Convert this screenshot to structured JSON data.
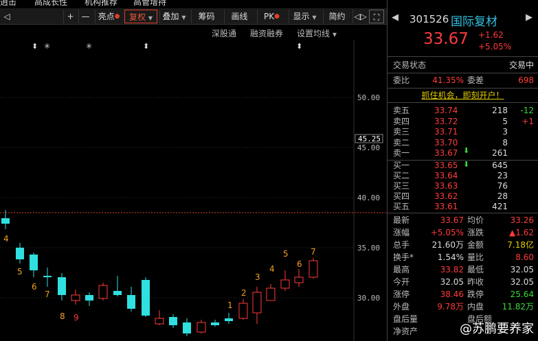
{
  "top_strip": [
    "逍击",
    "高成长性",
    "机构推荐",
    "高管增持"
  ],
  "toolbar": {
    "items": [
      {
        "label": "◁",
        "icon": "back-icon"
      },
      {
        "label": "+",
        "icon": "zoom-in-icon"
      },
      {
        "label": "—",
        "icon": "zoom-out-icon"
      },
      {
        "label": "亮点"
      },
      {
        "label": "复权"
      },
      {
        "label": "叠加"
      },
      {
        "label": "筹码"
      },
      {
        "label": "画线"
      },
      {
        "label": "PK"
      },
      {
        "label": "显示"
      },
      {
        "label": "简约"
      },
      {
        "label": "◁▷",
        "icon": "arrows-icon"
      },
      {
        "label": "⛶",
        "icon": "fullscreen-icon"
      }
    ]
  },
  "subbar": {
    "a": "深股通",
    "b": "融资融券",
    "c": "设置均线"
  },
  "chart": {
    "price_ref": "45.25",
    "y_labels": [
      "50.00",
      "45.00",
      "40.00",
      "35.00",
      "30.00"
    ],
    "markers": [
      "⬍",
      "✳",
      "✳",
      "⬍",
      "⬍"
    ],
    "count_labels": [
      "4",
      "5",
      "6",
      "7",
      "8",
      "9",
      "1",
      "2",
      "3",
      "4",
      "5",
      "6",
      "7"
    ]
  },
  "quote": {
    "code": "301526",
    "name": "国际复材",
    "price": "33.67",
    "change": "+1.62",
    "pct": "+5.05%",
    "status_label": "交易状态",
    "status_value": "交易中",
    "webi_label": "委比",
    "webi_value": "41.35%",
    "weicha_label": "委差",
    "weicha_value": "698",
    "promo": "抓住机会，即刻开户！",
    "colors": {
      "up": "#ff3b3b",
      "down": "#3bdb3b",
      "ask_bid": "#e6d000"
    }
  },
  "asks": [
    {
      "label": "卖五",
      "price": "33.74",
      "vol": "218",
      "delta": "-12"
    },
    {
      "label": "卖四",
      "price": "33.72",
      "vol": "5",
      "delta": "+1"
    },
    {
      "label": "卖三",
      "price": "33.71",
      "vol": "3",
      "delta": ""
    },
    {
      "label": "卖二",
      "price": "33.70",
      "vol": "8",
      "delta": ""
    },
    {
      "label": "卖一",
      "price": "33.67",
      "vol": "261",
      "delta": ""
    }
  ],
  "bids": [
    {
      "label": "买一",
      "price": "33.65",
      "vol": "645"
    },
    {
      "label": "买二",
      "price": "33.64",
      "vol": "23"
    },
    {
      "label": "买三",
      "price": "33.63",
      "vol": "76"
    },
    {
      "label": "买四",
      "price": "33.62",
      "vol": "28"
    },
    {
      "label": "买五",
      "price": "33.61",
      "vol": "421"
    }
  ],
  "stats": [
    {
      "l1": "最新",
      "v1": "33.67",
      "l2": "均价",
      "v2": "33.26"
    },
    {
      "l1": "涨幅",
      "v1": "+5.05%",
      "l2": "涨跌",
      "v2": "▲1.62"
    },
    {
      "l1": "总手",
      "v1": "21.60万",
      "l2": "金额",
      "v2": "7.18亿"
    },
    {
      "l1": "换手*",
      "v1": "1.54%",
      "l2": "量比",
      "v2": "8.60"
    },
    {
      "l1": "最高",
      "v1": "33.82",
      "l2": "最低",
      "v2": "32.05"
    },
    {
      "l1": "今开",
      "v1": "32.05",
      "l2": "昨收",
      "v2": "32.05"
    },
    {
      "l1": "涨停",
      "v1": "38.46",
      "l2": "跌停",
      "v2": "25.64"
    },
    {
      "l1": "外盘",
      "v1": "9.78万",
      "l2": "内盘",
      "v2": "11.82万"
    },
    {
      "l1": "盘后量",
      "v1": "",
      "l2": "盘后额",
      "v2": ""
    },
    {
      "l1": "净资产",
      "v1": "",
      "l2": "",
      "v2": ""
    }
  ],
  "watermark": "@苏鹏要养家"
}
